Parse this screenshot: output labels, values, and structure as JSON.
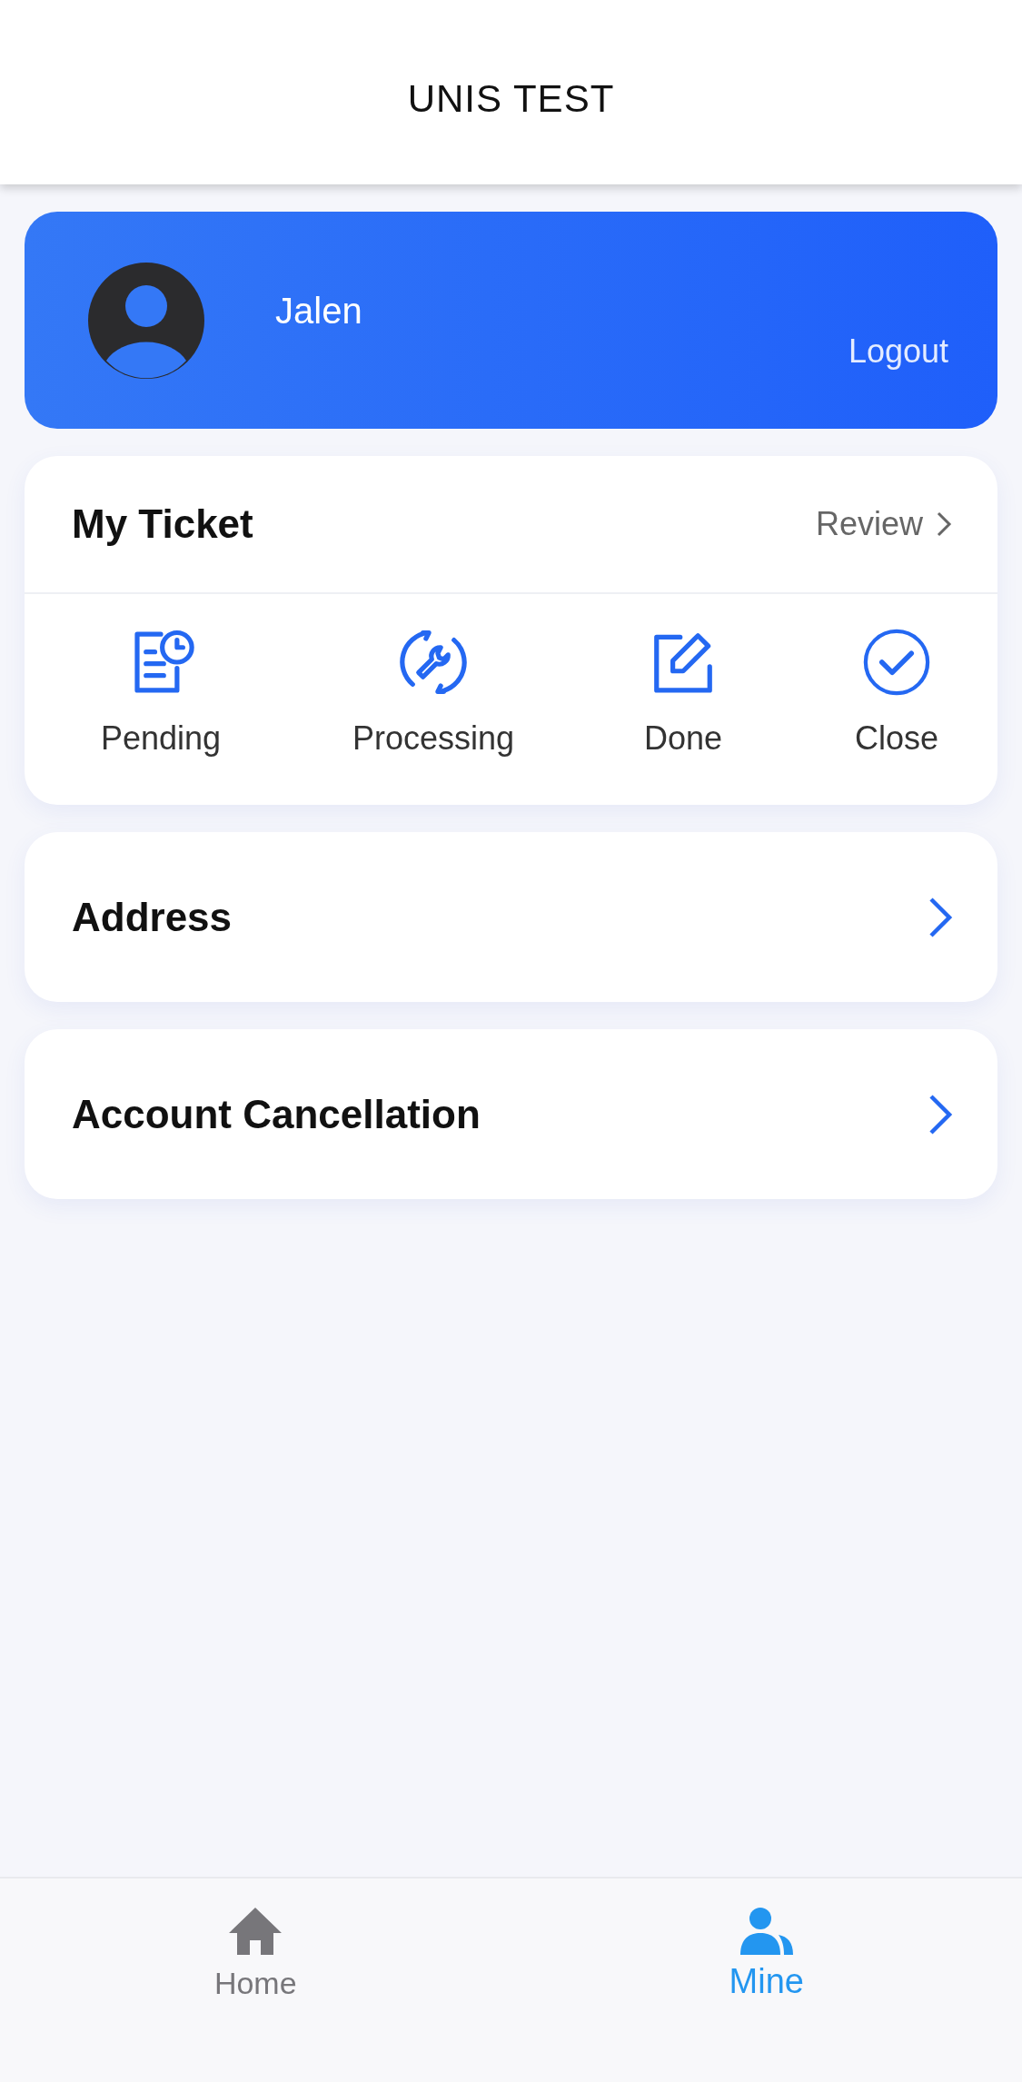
{
  "header": {
    "title": "UNIS TEST"
  },
  "profile": {
    "name": "Jalen",
    "logout": "Logout"
  },
  "ticket": {
    "title": "My Ticket",
    "link": "Review",
    "statuses": [
      {
        "label": "Pending"
      },
      {
        "label": "Processing"
      },
      {
        "label": "Done"
      },
      {
        "label": "Close"
      }
    ]
  },
  "menu": [
    {
      "label": "Address"
    },
    {
      "label": "Account Cancellation"
    }
  ],
  "tabbar": [
    {
      "label": "Home",
      "selected": false
    },
    {
      "label": "Mine",
      "selected": true
    }
  ]
}
